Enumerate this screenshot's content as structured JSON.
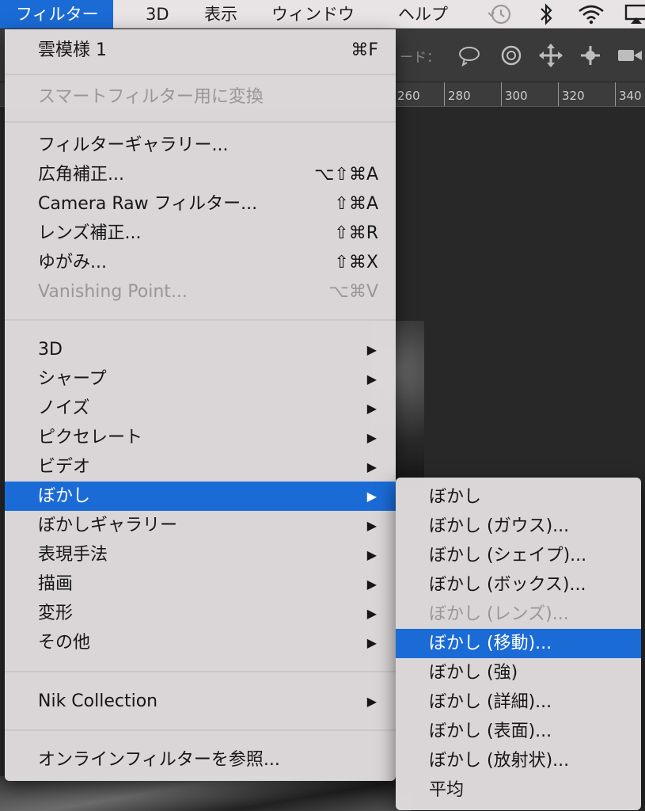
{
  "menubar": {
    "items": [
      {
        "label": "フィルター"
      },
      {
        "label": "3D"
      },
      {
        "label": "表示"
      },
      {
        "label": "ウィンドウ"
      },
      {
        "label": "ヘルプ"
      }
    ],
    "status_icons": [
      "time-machine-icon",
      "bluetooth-icon",
      "wifi-icon",
      "airplay-icon"
    ]
  },
  "options_bar": {
    "mode_label": "ード："
  },
  "ruler": {
    "ticks": [
      "260",
      "280",
      "300",
      "320",
      "340"
    ]
  },
  "filter_menu": {
    "last_filter": {
      "label": "雲模様 1",
      "shortcut": "⌘F"
    },
    "smart_filter": {
      "label": "スマートフィルター用に変換"
    },
    "gallery": {
      "label": "フィルターギャラリー..."
    },
    "adaptive_wide": {
      "label": "広角補正...",
      "shortcut": "⌥⇧⌘A"
    },
    "camera_raw": {
      "label": "Camera Raw フィルター...",
      "shortcut": "⇧⌘A"
    },
    "lens_correction": {
      "label": "レンズ補正...",
      "shortcut": "⇧⌘R"
    },
    "liquify": {
      "label": "ゆがみ...",
      "shortcut": "⇧⌘X"
    },
    "vanishing_point": {
      "label": "Vanishing Point...",
      "shortcut": "⌥⌘V"
    },
    "groups": [
      {
        "label": "3D"
      },
      {
        "label": "シャープ"
      },
      {
        "label": "ノイズ"
      },
      {
        "label": "ピクセレート"
      },
      {
        "label": "ビデオ"
      },
      {
        "label": "ぼかし"
      },
      {
        "label": "ぼかしギャラリー"
      },
      {
        "label": "表現手法"
      },
      {
        "label": "描画"
      },
      {
        "label": "変形"
      },
      {
        "label": "その他"
      }
    ],
    "nik": {
      "label": "Nik Collection"
    },
    "browse_online": {
      "label": "オンラインフィルターを参照..."
    },
    "submenu_arrow": "▶"
  },
  "blur_submenu": {
    "items": [
      {
        "label": "ぼかし"
      },
      {
        "label": "ぼかし (ガウス)..."
      },
      {
        "label": "ぼかし (シェイプ)..."
      },
      {
        "label": "ぼかし (ボックス)..."
      },
      {
        "label": "ぼかし (レンズ)..."
      },
      {
        "label": "ぼかし (移動)..."
      },
      {
        "label": "ぼかし (強)"
      },
      {
        "label": "ぼかし (詳細)..."
      },
      {
        "label": "ぼかし (表面)..."
      },
      {
        "label": "ぼかし (放射状)..."
      },
      {
        "label": "平均"
      }
    ]
  },
  "colors": {
    "highlight": "#1b6bd6",
    "menu_bg": "#e0dcde",
    "disabled_text": "#9a9698"
  }
}
